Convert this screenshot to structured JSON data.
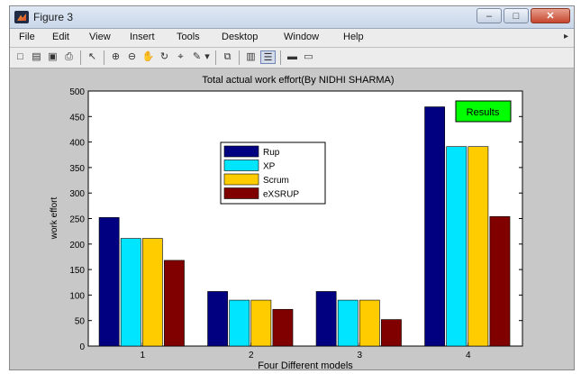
{
  "window": {
    "title": "Figure 3",
    "controls": {
      "minimize": "–",
      "maximize": "□",
      "close": "✕"
    }
  },
  "menu": [
    "File",
    "Edit",
    "View",
    "Insert",
    "Tools",
    "Desktop",
    "Window",
    "Help"
  ],
  "menu_overflow": "▸",
  "toolbar": {
    "icons": [
      {
        "name": "new-figure-icon",
        "glyph": "□"
      },
      {
        "name": "open-file-icon",
        "glyph": "▤"
      },
      {
        "name": "save-icon",
        "glyph": "▣"
      },
      {
        "name": "print-icon",
        "glyph": "⎙"
      },
      {
        "name": "edit-plot-arrow-icon",
        "glyph": "↖"
      },
      {
        "name": "zoom-in-icon",
        "glyph": "⊕"
      },
      {
        "name": "zoom-out-icon",
        "glyph": "⊖"
      },
      {
        "name": "pan-hand-icon",
        "glyph": "✋"
      },
      {
        "name": "rotate-3d-icon",
        "glyph": "↻"
      },
      {
        "name": "data-cursor-icon",
        "glyph": "⌖"
      },
      {
        "name": "brush-icon",
        "glyph": "✎"
      },
      {
        "name": "brush-dropdown-icon",
        "glyph": "▾"
      },
      {
        "name": "link-plot-icon",
        "glyph": "⧉"
      },
      {
        "name": "colorbar-icon",
        "glyph": "▥"
      },
      {
        "name": "legend-icon",
        "glyph": "☰"
      },
      {
        "name": "hide-plot-tools-icon",
        "glyph": "▬"
      },
      {
        "name": "show-plot-tools-icon",
        "glyph": "▭"
      }
    ]
  },
  "results_button": {
    "label": "Results",
    "color": "#00ff00"
  },
  "chart_data": {
    "type": "bar",
    "title": "Total actual work effort(By NIDHI SHARMA)",
    "xlabel": "Four Different models",
    "ylabel": "work effort",
    "categories": [
      "1",
      "2",
      "3",
      "4"
    ],
    "ylim": [
      0,
      500
    ],
    "yticks": [
      0,
      50,
      100,
      150,
      200,
      250,
      300,
      350,
      400,
      450,
      500
    ],
    "series": [
      {
        "name": "Rup",
        "color": "#000080",
        "values": [
          252,
          107,
          107,
          469
        ]
      },
      {
        "name": "XP",
        "color": "#00e5ff",
        "values": [
          211,
          90,
          90,
          391
        ]
      },
      {
        "name": "Scrum",
        "color": "#ffcc00",
        "values": [
          211,
          90,
          90,
          391
        ]
      },
      {
        "name": "eXSRUP",
        "color": "#800000",
        "values": [
          168,
          72,
          52,
          254
        ]
      }
    ],
    "legend_position": "upper-center",
    "grid": false
  }
}
